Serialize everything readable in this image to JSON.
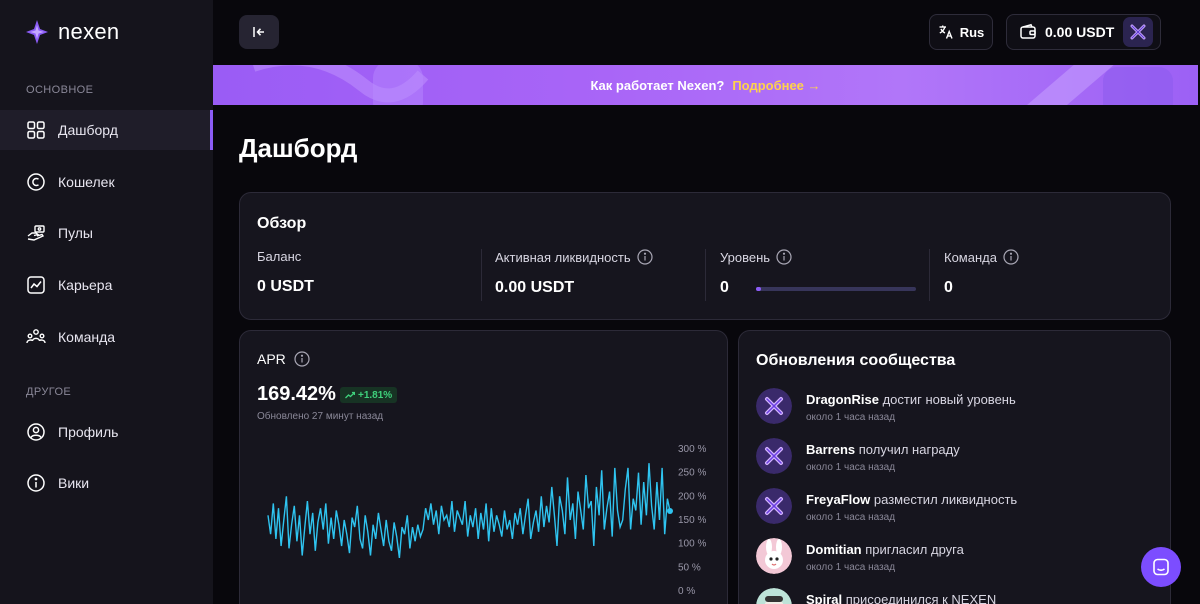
{
  "app": {
    "name": "nexen",
    "accent": "#8b5cf6"
  },
  "sidebar": {
    "section_main": "ОСНОВНОЕ",
    "section_other": "ДРУГОЕ",
    "items": [
      {
        "label": "Дашборд",
        "icon": "dashboard-icon",
        "active": true
      },
      {
        "label": "Кошелек",
        "icon": "wallet-coin-icon"
      },
      {
        "label": "Пулы",
        "icon": "pools-icon"
      },
      {
        "label": "Карьера",
        "icon": "career-chart-icon"
      },
      {
        "label": "Команда",
        "icon": "team-icon"
      },
      {
        "label": "Профиль",
        "icon": "profile-icon"
      },
      {
        "label": "Вики",
        "icon": "info-icon"
      }
    ]
  },
  "topbar": {
    "language": "Rus",
    "balance": "0.00 USDT"
  },
  "banner": {
    "text": "Как работает Nexen?",
    "link": "Подробнее →"
  },
  "page": {
    "title": "Дашборд"
  },
  "overview": {
    "title": "Обзор",
    "balance_label": "Баланс",
    "balance_value": "0 USDT",
    "liquidity_label": "Активная ликвидность",
    "liquidity_value": "0.00 USDT",
    "level_label": "Уровень",
    "level_value": "0",
    "level_progress": 0.03,
    "team_label": "Команда",
    "team_value": "0"
  },
  "apr": {
    "title": "APR",
    "value": "169.42%",
    "change": "+1.81%",
    "updated": "Обновлено 27 минут назад",
    "change_color": "#3fd17c"
  },
  "chart_data": {
    "type": "line",
    "ylim": [
      0,
      300
    ],
    "y_ticks": [
      "300 %",
      "250 %",
      "200 %",
      "150 %",
      "100 %",
      "50 %",
      "0 %"
    ],
    "series": [
      {
        "values": [
          160,
          120,
          185,
          110,
          175,
          95,
          150,
          200,
          90,
          140,
          180,
          105,
          160,
          75,
          135,
          190,
          120,
          165,
          85,
          145,
          175,
          130,
          185,
          100,
          155,
          110,
          170,
          140,
          95,
          150,
          120,
          80,
          155,
          135,
          180,
          110,
          90,
          160,
          125,
          75,
          140,
          110,
          165,
          130,
          95,
          150,
          105,
          85,
          145,
          115,
          70,
          135,
          120,
          160,
          90,
          135,
          105,
          140,
          115,
          130,
          175,
          150,
          185,
          140,
          170,
          120,
          180,
          150,
          160,
          135,
          190,
          125,
          170,
          155,
          140,
          190,
          115,
          160,
          135,
          175,
          110,
          165,
          130,
          185,
          105,
          175,
          125,
          160,
          140,
          115,
          170,
          130,
          150,
          110,
          165,
          140,
          175,
          120,
          160,
          195,
          110,
          145,
          170,
          125,
          200,
          135,
          180,
          145,
          220,
          160,
          95,
          200,
          170,
          120,
          240,
          150,
          185,
          110,
          210,
          170,
          130,
          245,
          175,
          190,
          95,
          220,
          160,
          255,
          130,
          175,
          210,
          115,
          260,
          170,
          135,
          150,
          215,
          260,
          130,
          195,
          170,
          250,
          140,
          230,
          160,
          270,
          180,
          130,
          230,
          150,
          260,
          120,
          195,
          169
        ]
      }
    ]
  },
  "community": {
    "title": "Обновления сообщества",
    "events": [
      {
        "name": "DragonRise",
        "action": " достиг новый уровень",
        "time": "около 1 часа назад",
        "avatar": "x-logo-avatar"
      },
      {
        "name": "Barrens",
        "action": " получил награду",
        "time": "около 1 часа назад",
        "avatar": "x-logo-avatar"
      },
      {
        "name": "FreyaFlow",
        "action": " разместил ликвидность",
        "time": "около 1 часа назад",
        "avatar": "x-logo-avatar"
      },
      {
        "name": "Domitian",
        "action": " пригласил друга",
        "time": "около 1 часа назад",
        "avatar": "bunny-avatar"
      },
      {
        "name": "Spiral",
        "action": " присоединился к NEXEN",
        "time": "",
        "avatar": "character-avatar"
      }
    ]
  }
}
